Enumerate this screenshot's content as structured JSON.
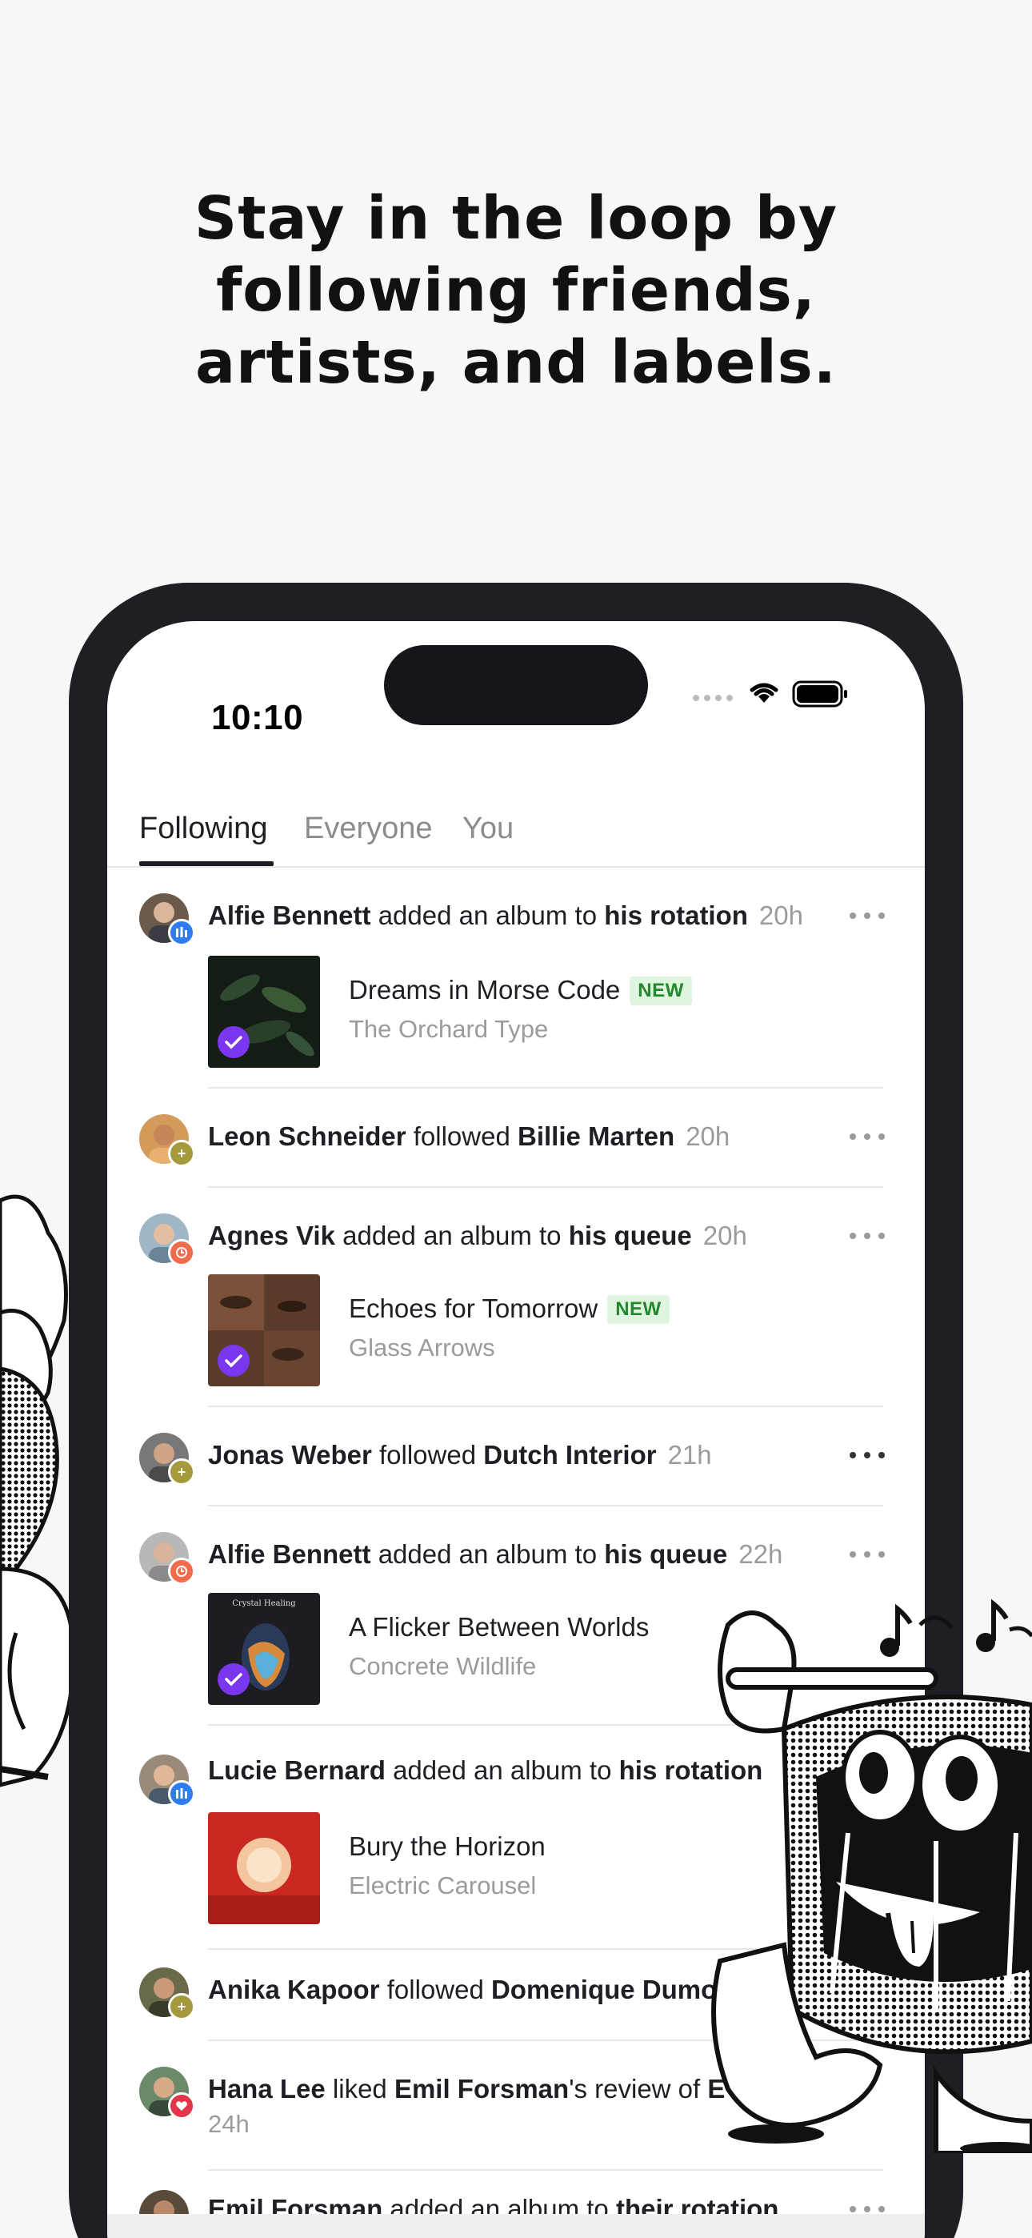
{
  "headline": [
    "Stay in the loop by",
    "following friends,",
    "artists, and labels."
  ],
  "status": {
    "time": "10:10"
  },
  "tabs": [
    {
      "label": "Following",
      "active": true
    },
    {
      "label": "Everyone",
      "active": false
    },
    {
      "label": "You",
      "active": false
    }
  ],
  "feed": [
    {
      "user": "Alfie Bennett",
      "action": "added an album to",
      "target": "his rotation",
      "time": "20h",
      "badge": "rotation",
      "album": {
        "title": "Dreams in Morse Code",
        "artist": "The Orchard Type",
        "new": "NEW"
      }
    },
    {
      "user": "Leon Schneider",
      "action": "followed",
      "target": "Billie Marten",
      "time": "20h",
      "badge": "follow"
    },
    {
      "user": "Agnes Vik",
      "action": "added an album to",
      "target": "his queue",
      "time": "20h",
      "badge": "queue",
      "album": {
        "title": "Echoes for Tomorrow",
        "artist": "Glass Arrows",
        "new": "NEW"
      }
    },
    {
      "user": "Jonas Weber",
      "action": "followed",
      "target": "Dutch Interior",
      "time": "21h",
      "badge": "follow"
    },
    {
      "user": "Alfie Bennett",
      "action": "added an album to",
      "target": "his queue",
      "time": "22h",
      "badge": "queue",
      "album": {
        "title": "A Flicker Between Worlds",
        "artist": "Concrete Wildlife",
        "cover_text": "Crystal Healing"
      }
    },
    {
      "user": "Lucie Bernard",
      "action": "added an album to",
      "target": "his rotation",
      "time": "",
      "badge": "rotation",
      "album": {
        "title": "Bury the Horizon",
        "artist": "Electric Carousel"
      }
    },
    {
      "user": "Anika Kapoor",
      "action": "followed",
      "target": "Domenique Dumont",
      "time": "",
      "badge": "follow"
    },
    {
      "user": "Hana Lee",
      "action": "liked",
      "target": "Emil Forsman",
      "suffix": "'s review of",
      "extra": "E",
      "time": "24h",
      "badge": "like"
    },
    {
      "user": "Emil Forsman",
      "action": "added an album to",
      "target": "their rotation",
      "time": "",
      "badge": "rotation"
    }
  ]
}
